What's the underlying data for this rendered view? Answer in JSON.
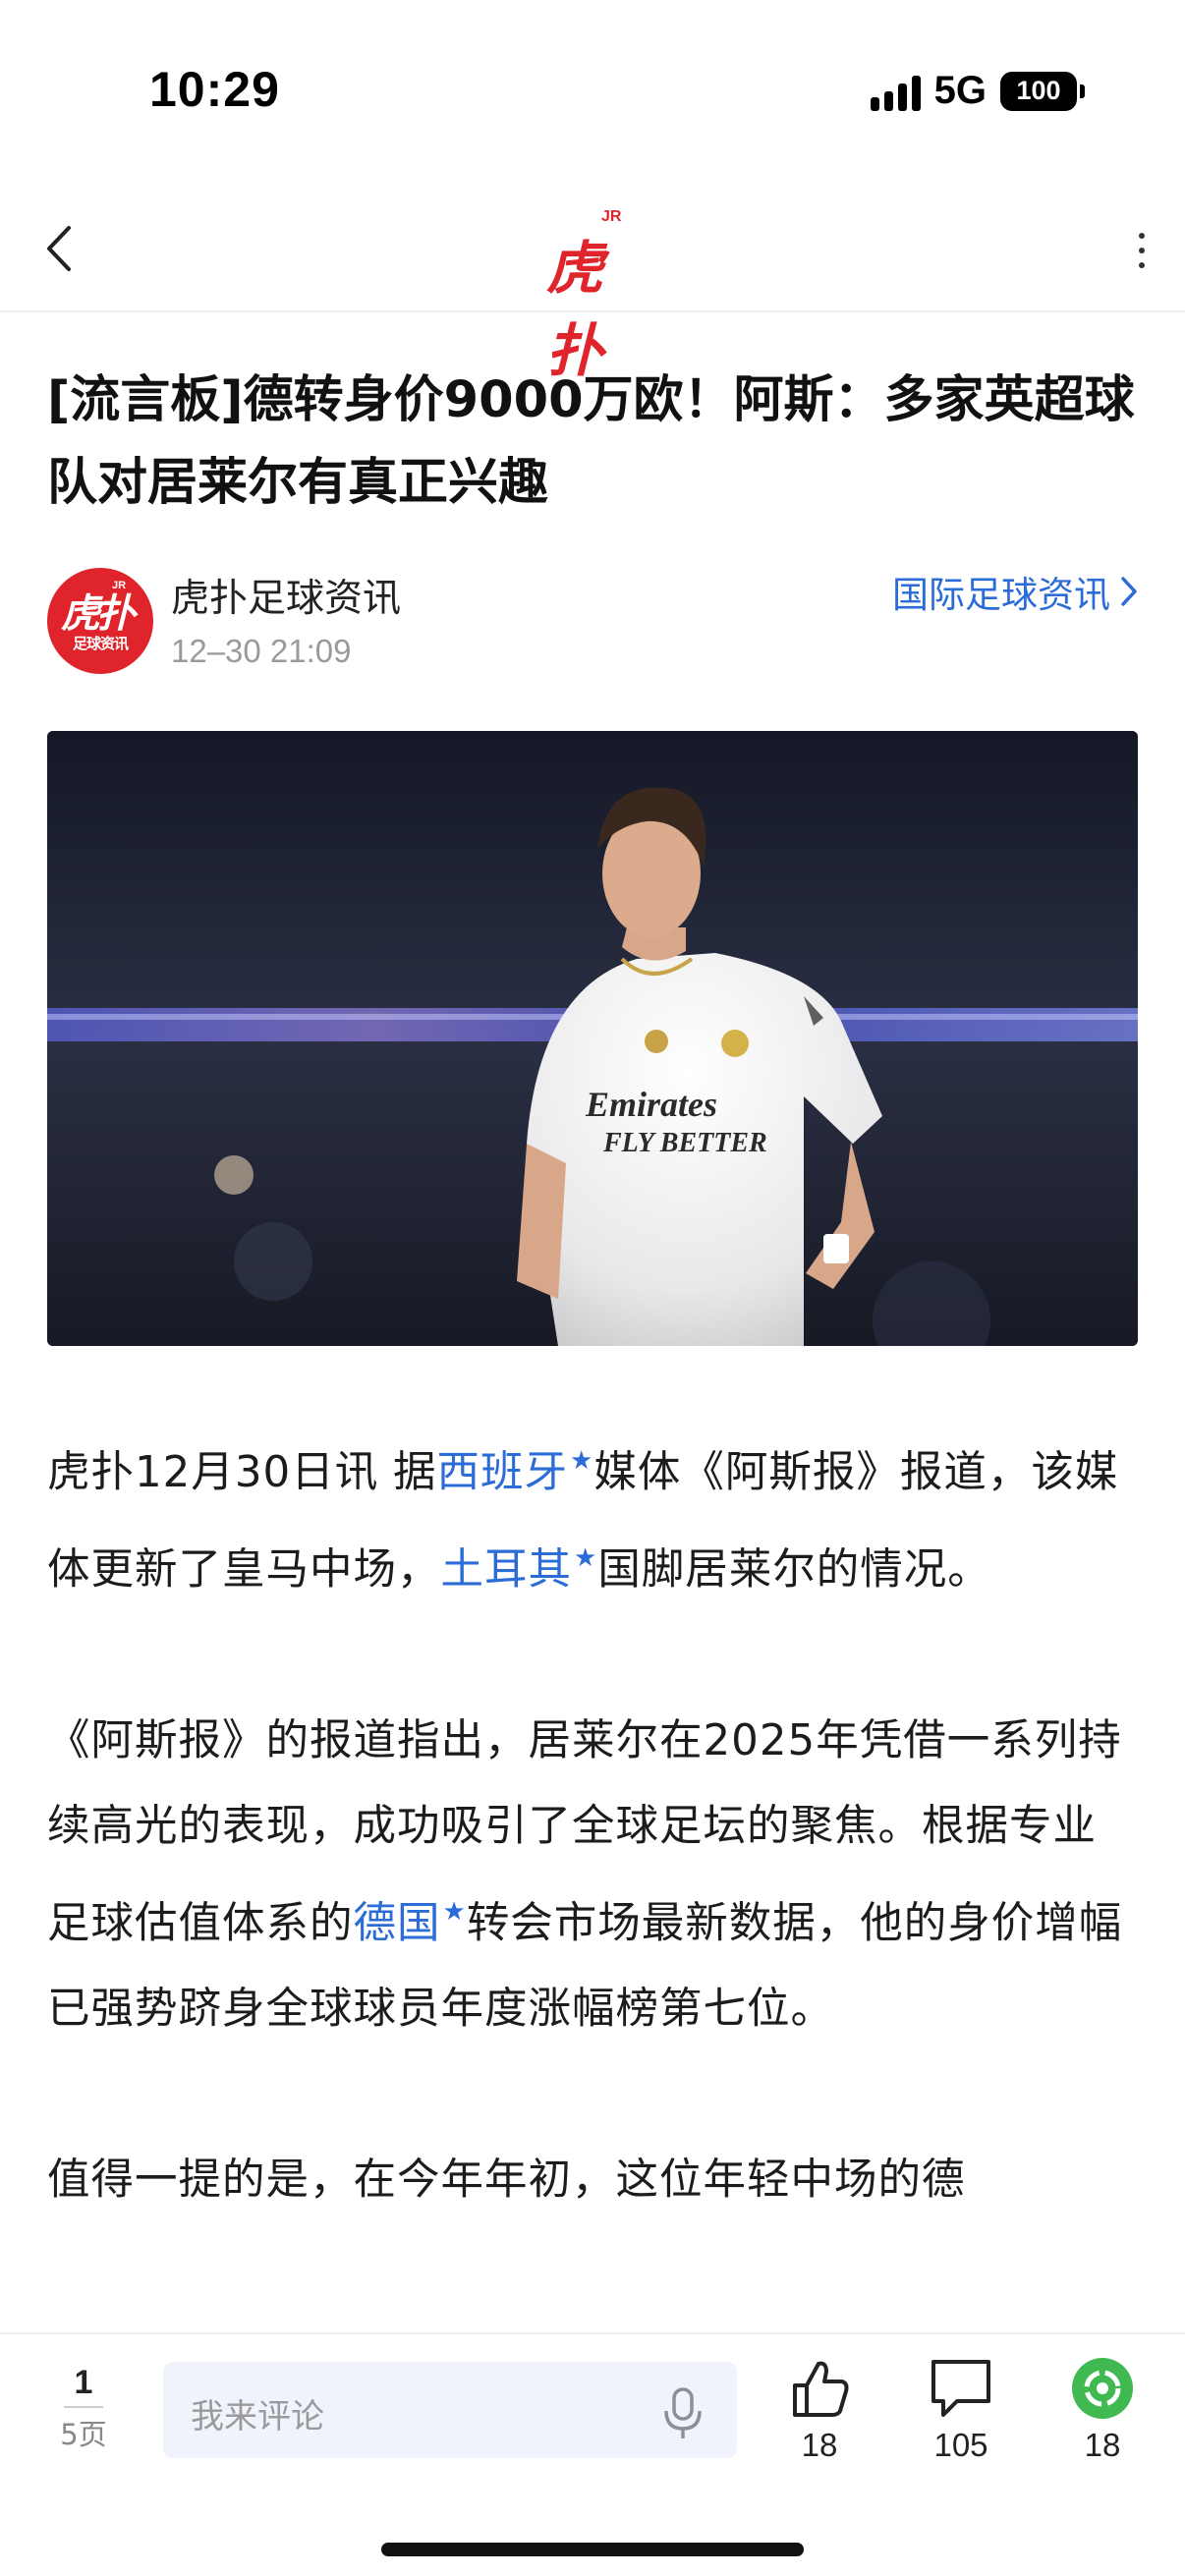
{
  "status_bar": {
    "time": "10:29",
    "network": "5G",
    "battery": "100"
  },
  "nav": {
    "logo_text": "虎扑",
    "logo_badge": "JR",
    "back_icon": "chevron-left-icon",
    "more_icon": "more-vertical-icon"
  },
  "article": {
    "title": "[流言板]德转身价9000万欧！阿斯：多家英超球队对居莱尔有真正兴趣",
    "author": {
      "avatar_text": "虎扑",
      "avatar_badge": "JR",
      "avatar_subtext": "足球资讯",
      "name": "虎扑足球资讯",
      "time": "12–30 21:09"
    },
    "category_link": "国际足球资讯",
    "paragraphs": {
      "p1": {
        "a": "虎扑12月30日讯 据",
        "entity1": "西班牙",
        "b": "媒体《阿斯报》报道，该媒体更新了皇马中场，",
        "entity2": "土耳其",
        "c": "国脚居莱尔的情况。"
      },
      "p2": {
        "a": "《阿斯报》的报道指出，居莱尔在2025年凭借一系列持续高光的表现，成功吸引了全球足坛的聚焦。根据专业足球估值体系的",
        "entity1": "德国",
        "b": "转会市场最新数据，他的身价增幅已强势跻身全球球员年度涨幅榜第七位。"
      },
      "p3": {
        "a": "值得一提的是，在今年年初，这位年轻中场的德"
      }
    },
    "entity_star": "★"
  },
  "bottom_bar": {
    "page_current": "1",
    "page_total": "5页",
    "comment_placeholder": "我来评论",
    "like_count": "18",
    "comment_count": "105",
    "share_count": "18"
  },
  "colors": {
    "brand_red": "#e0242b",
    "link_blue": "#2b6cd6",
    "share_green": "#3fb950"
  }
}
